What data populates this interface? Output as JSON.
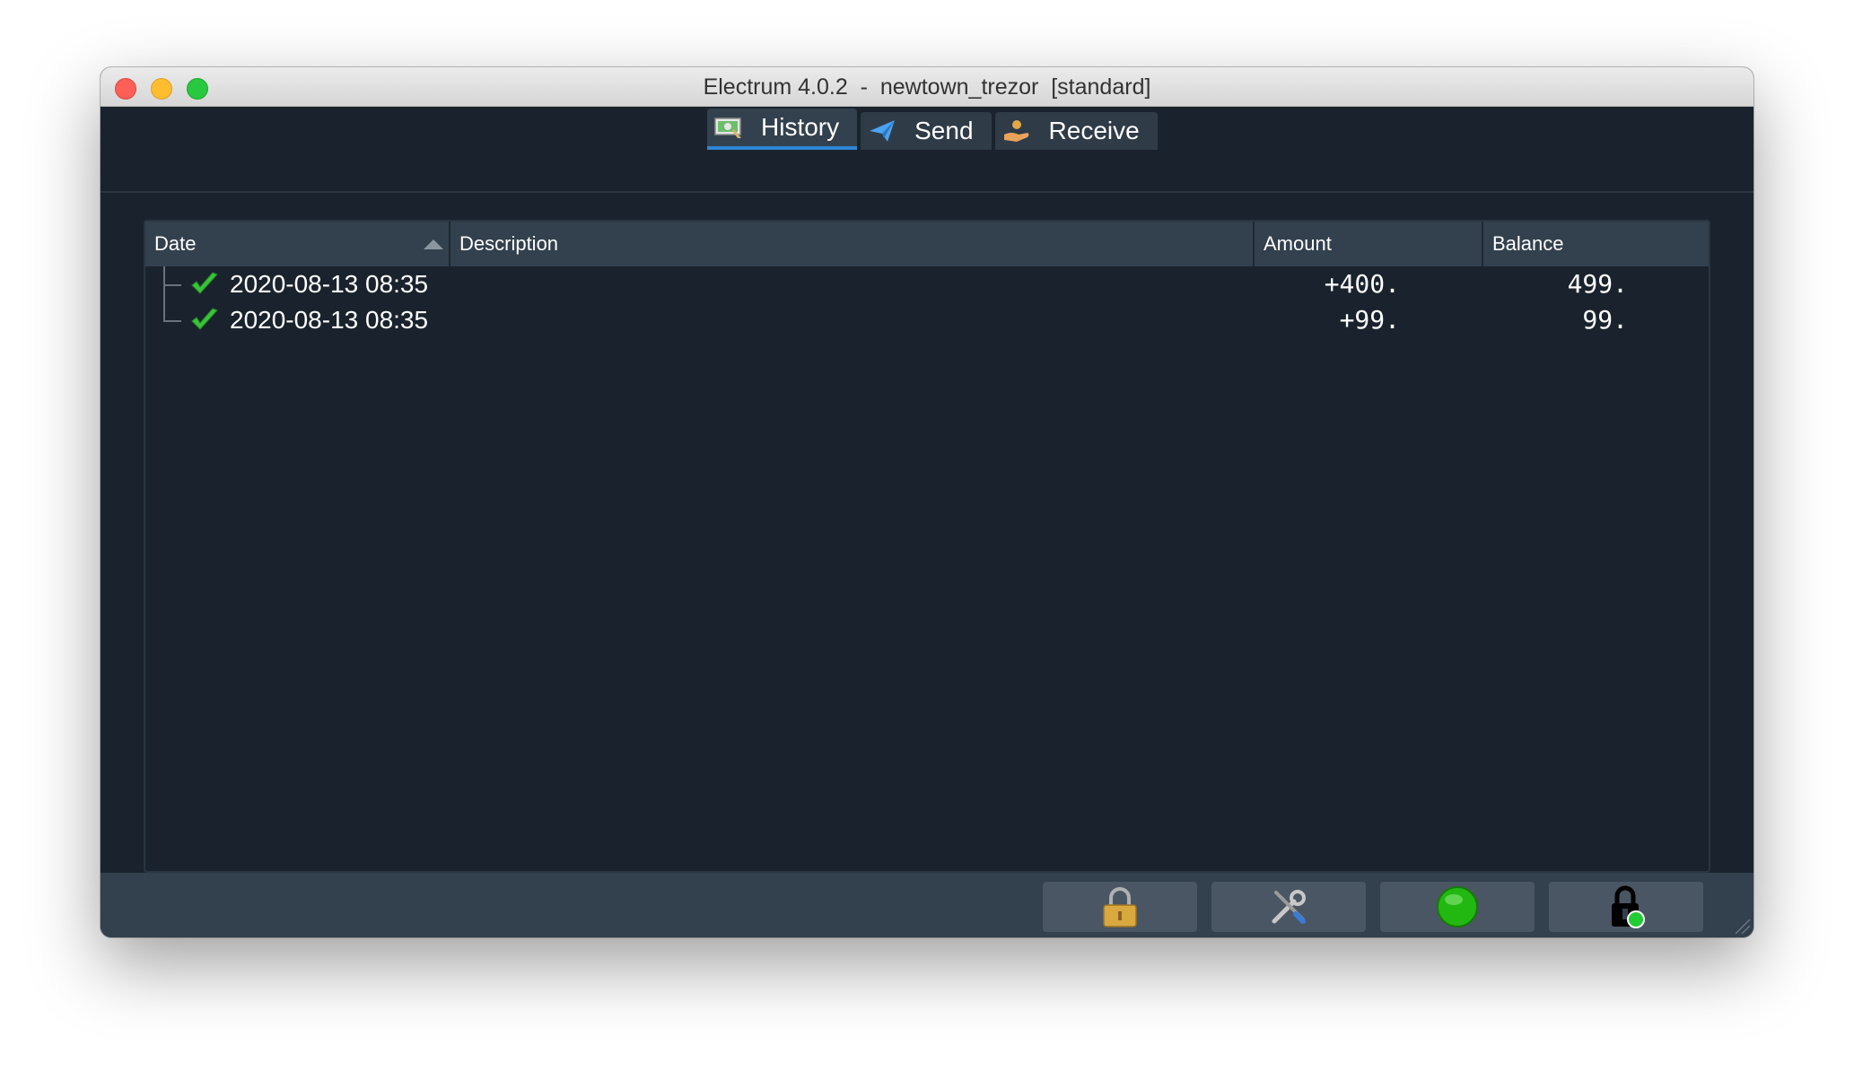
{
  "window": {
    "title": "Electrum 4.0.2  -  newtown_trezor  [standard]"
  },
  "tabs": [
    {
      "label": "History",
      "icon": "history-icon",
      "active": true
    },
    {
      "label": "Send",
      "icon": "send-icon",
      "active": false
    },
    {
      "label": "Receive",
      "icon": "receive-icon",
      "active": false
    }
  ],
  "table": {
    "columns": [
      "Date",
      "Description",
      "Amount",
      "Balance"
    ],
    "sort_column": "Date",
    "rows": [
      {
        "status_icon": "confirmed-check-icon",
        "date": "2020-08-13 08:35",
        "description": "",
        "amount": "+400.",
        "balance": "499."
      },
      {
        "status_icon": "confirmed-check-icon",
        "date": "2020-08-13 08:35",
        "description": "",
        "amount": "+99.",
        "balance": "99."
      }
    ]
  },
  "statusbar": {
    "buttons": [
      {
        "icon": "padlock-icon"
      },
      {
        "icon": "tools-icon"
      },
      {
        "icon": "network-status-green-icon"
      },
      {
        "icon": "trezor-connected-icon"
      }
    ]
  },
  "colors": {
    "background": "#1a232d",
    "header": "#33404d",
    "tab_active_underline": "#2d86d6",
    "check_green": "#3cc23c",
    "status_green": "#22b811"
  }
}
